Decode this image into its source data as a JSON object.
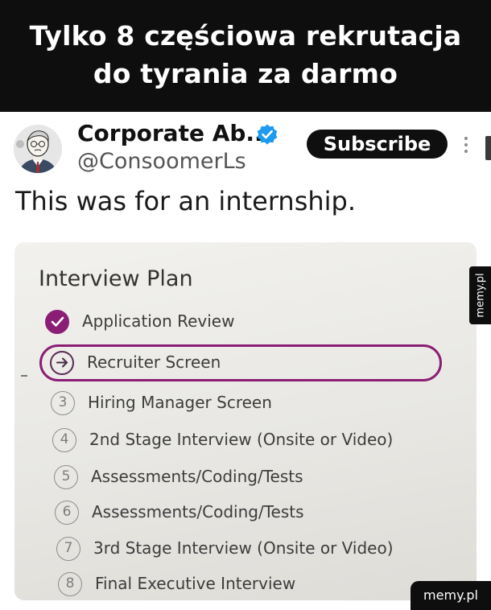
{
  "meme": {
    "title_lines": [
      "Tylko 8 częściowa rekrutacja",
      "do tyrania za darmo"
    ]
  },
  "tweet": {
    "author_name": "Corporate Ab...",
    "handle": "@ConsoomerLs",
    "subscribe_label": "Subscribe",
    "text": "This was for an internship.",
    "accent_color": "#1d9bf0"
  },
  "interview_plan": {
    "title": "Interview Plan",
    "accent_color": "#8a1e75",
    "steps": [
      {
        "marker": "",
        "label": "Application Review",
        "status": "completed"
      },
      {
        "marker": "",
        "label": "Recruiter Screen",
        "status": "current"
      },
      {
        "marker": "3",
        "label": "Hiring Manager Screen",
        "status": "pending"
      },
      {
        "marker": "4",
        "label": "2nd Stage Interview (Onsite or Video)",
        "status": "pending"
      },
      {
        "marker": "5",
        "label": "Assessments/Coding/Tests",
        "status": "pending"
      },
      {
        "marker": "6",
        "label": "Assessments/Coding/Tests",
        "status": "pending"
      },
      {
        "marker": "7",
        "label": "3rd Stage Interview (Onsite or Video)",
        "status": "pending"
      },
      {
        "marker": "8",
        "label": "Final Executive Interview",
        "status": "pending"
      }
    ]
  },
  "watermark": {
    "side": "memy.pl",
    "corner": "memy.pl"
  }
}
